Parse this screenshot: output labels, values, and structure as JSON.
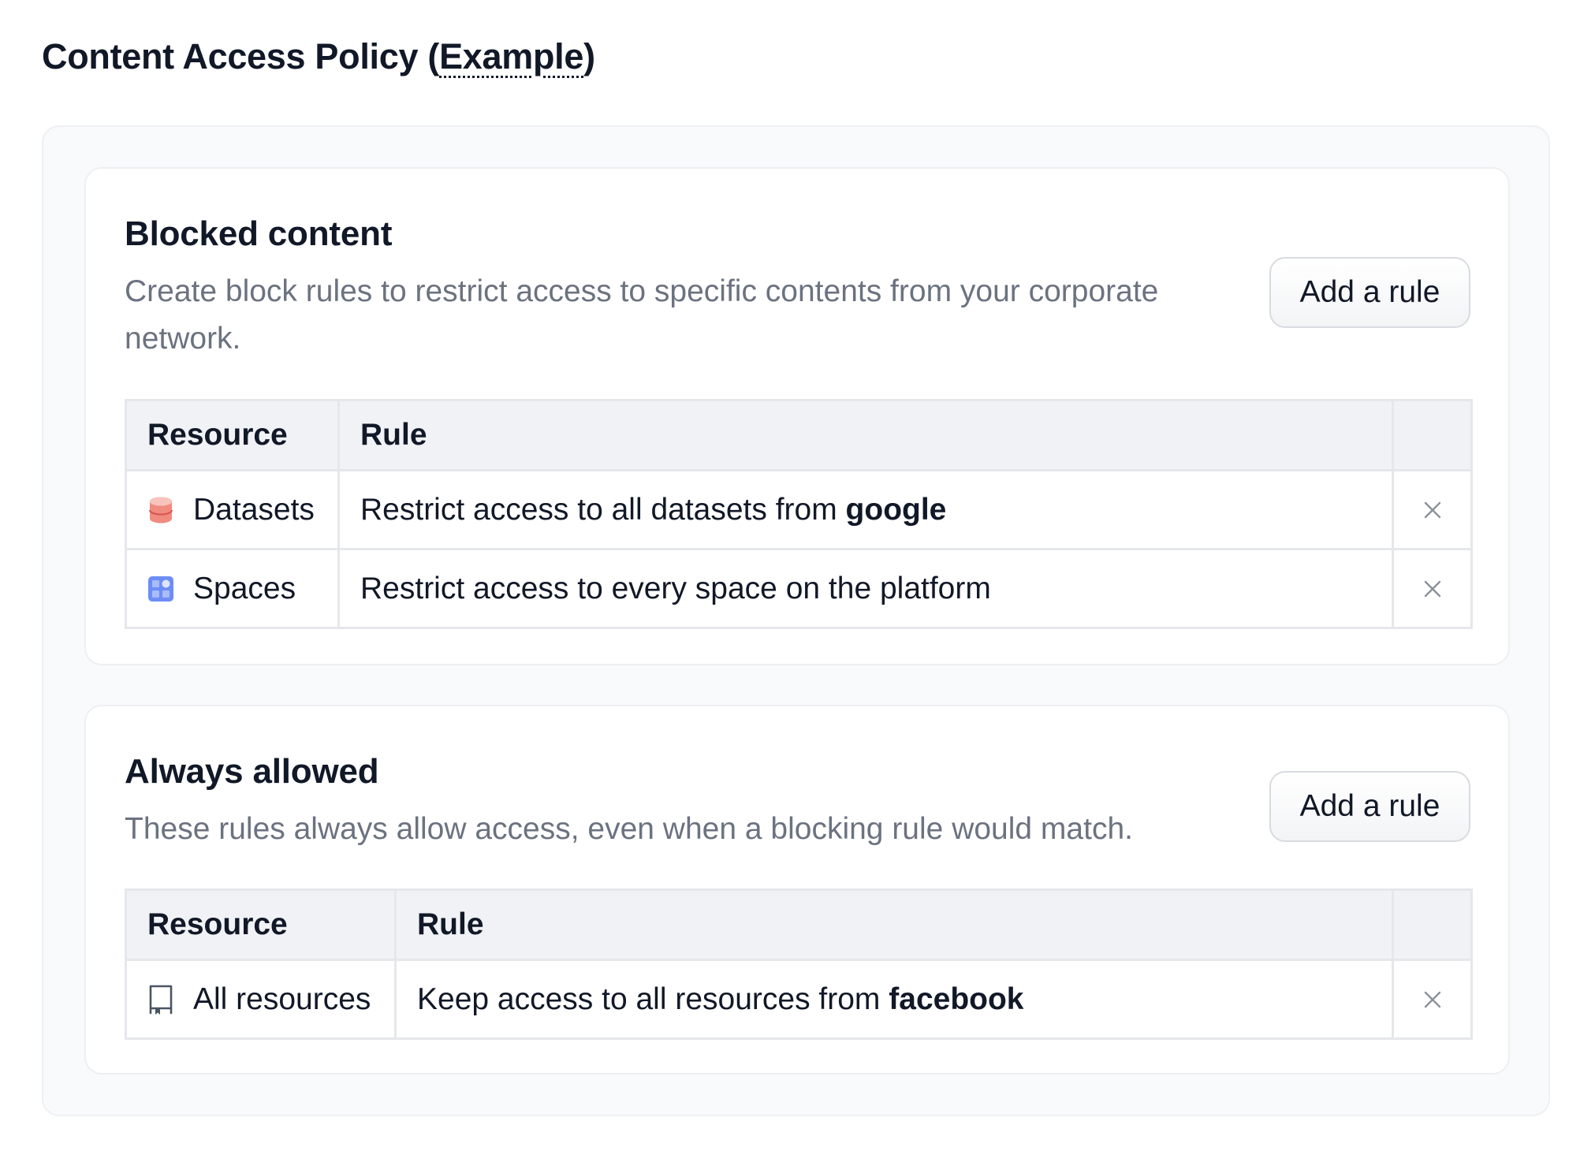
{
  "page": {
    "title_prefix": "Content Access Policy (",
    "title_abbr": "Example",
    "title_suffix": ")"
  },
  "blocked": {
    "title": "Blocked content",
    "description": "Create block rules to restrict access to specific contents from your corporate network.",
    "add_button": "Add a rule",
    "columns": [
      "Resource",
      "Rule",
      ""
    ],
    "rows": [
      {
        "icon": "datasets-icon",
        "resource": "Datasets",
        "rule_text": "Restrict access to all datasets from ",
        "rule_target": "google"
      },
      {
        "icon": "spaces-icon",
        "resource": "Spaces",
        "rule_text": "Restrict access to every space on the platform",
        "rule_target": ""
      }
    ]
  },
  "allowed": {
    "title": "Always allowed",
    "description": "These rules always allow access, even when a blocking rule would match.",
    "add_button": "Add a rule",
    "columns": [
      "Resource",
      "Rule",
      ""
    ],
    "rows": [
      {
        "icon": "repository-icon",
        "resource": "All resources",
        "rule_text": "Keep access to all resources from ",
        "rule_target": "facebook"
      }
    ]
  },
  "colors": {
    "datasets_icon": "#ef8b7f",
    "spaces_icon": "#6d8df5",
    "muted_text": "#6b7280",
    "header_bg": "#f1f2f5"
  }
}
